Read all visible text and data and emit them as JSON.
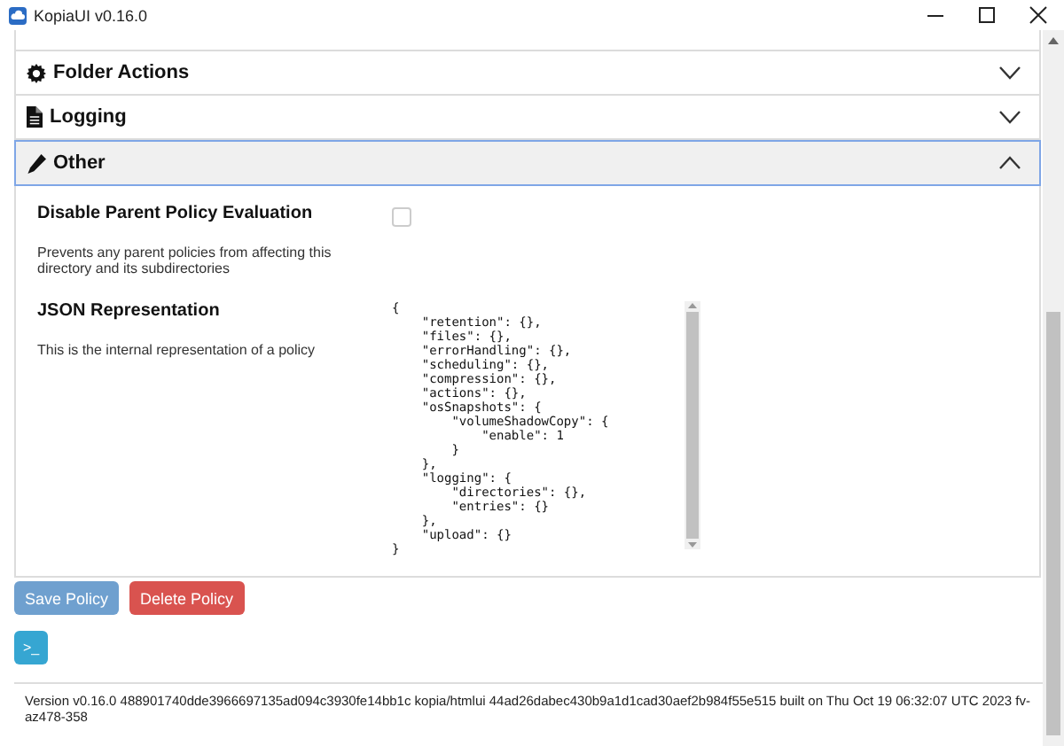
{
  "window": {
    "title": "KopiaUI v0.16.0"
  },
  "sections": [
    {
      "title": "Folder Actions",
      "kind": "gear",
      "expanded": false
    },
    {
      "title": "Logging",
      "kind": "file",
      "expanded": false
    },
    {
      "title": "Other",
      "kind": "pencil",
      "expanded": true
    }
  ],
  "other": {
    "fields": [
      {
        "kind": "checkbox",
        "label": "Disable Parent Policy Evaluation",
        "help": "Prevents any parent policies from affecting this directory and its subdirectories",
        "checked": false
      },
      {
        "kind": "json",
        "label": "JSON Representation",
        "help": "This is the internal representation of a policy",
        "value": "{\n    \"retention\": {},\n    \"files\": {},\n    \"errorHandling\": {},\n    \"scheduling\": {},\n    \"compression\": {},\n    \"actions\": {},\n    \"osSnapshots\": {\n        \"volumeShadowCopy\": {\n            \"enable\": 1\n        }\n    },\n    \"logging\": {\n        \"directories\": {},\n        \"entries\": {}\n    },\n    \"upload\": {}\n}"
      }
    ]
  },
  "buttons": [
    {
      "label": "Save Policy",
      "kind": "primary",
      "disabled": true
    },
    {
      "label": "Delete Policy",
      "kind": "danger",
      "disabled": false
    }
  ],
  "terminal_button": {
    "label": ">_"
  },
  "footer": "Version v0.16.0 488901740dde3966697135ad094c3930fe14bb1c kopia/htmlui 44ad26dabec430b9a1d1cad30aef2b984f55e515 built on Thu Oct 19 06:32:07 UTC 2023 fv-az478-358"
}
